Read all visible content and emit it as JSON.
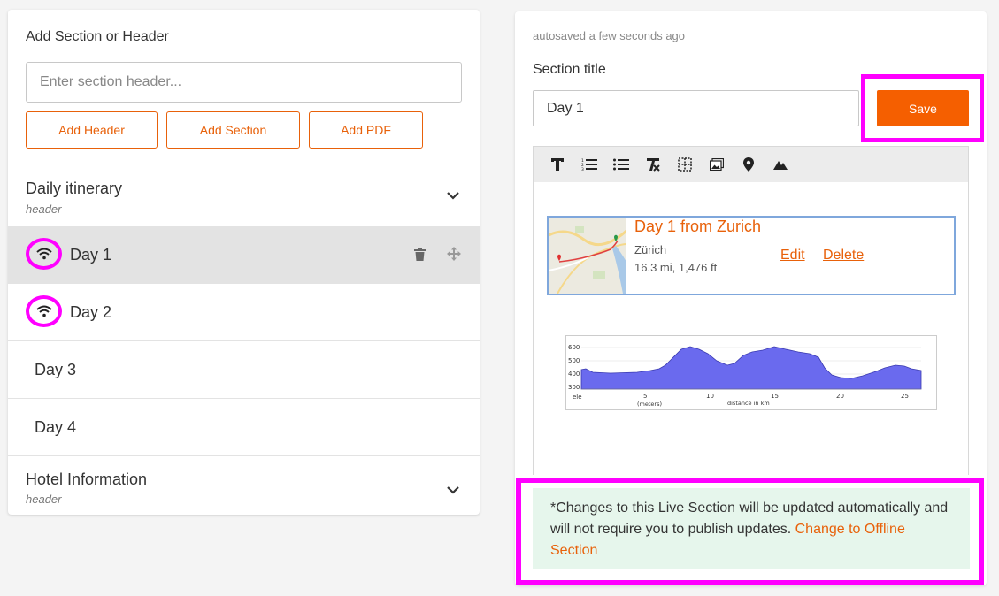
{
  "left": {
    "add_title": "Add Section or Header",
    "input_placeholder": "Enter section header...",
    "buttons": {
      "add_header": "Add Header",
      "add_section": "Add Section",
      "add_pdf": "Add PDF"
    },
    "groups": [
      {
        "title": "Daily itinerary",
        "subtitle": "header"
      },
      {
        "title": "Hotel Information",
        "subtitle": "header"
      }
    ],
    "days": [
      {
        "label": "Day 1"
      },
      {
        "label": "Day 2"
      },
      {
        "label": "Day 3"
      },
      {
        "label": "Day 4"
      }
    ]
  },
  "right": {
    "autosave": "autosaved a few seconds ago",
    "section_title_label": "Section title",
    "section_title_value": "Day 1",
    "save_label": "Save",
    "toolbar_icons": [
      "text-format-icon",
      "numbered-list-icon",
      "bullet-list-icon",
      "clear-format-icon",
      "table-icon",
      "image-icon",
      "map-pin-icon",
      "mountain-icon"
    ],
    "map_card": {
      "title": "Day 1 from Zurich",
      "location": "Zürich",
      "stats": "16.3 mi, 1,476 ft",
      "edit": "Edit",
      "delete": "Delete"
    },
    "elevation": {
      "y_ticks": [
        "600",
        "500",
        "400",
        "300"
      ],
      "x_ticks": [
        "5",
        "10",
        "15",
        "20",
        "25"
      ],
      "y_label": "ele",
      "y_unit": "(meters)",
      "x_label": "distance in km"
    },
    "notice": {
      "text": "*Changes to this Live Section will be updated automatically and will not require you to publish updates. ",
      "link": "Change to Offline Section"
    }
  },
  "colors": {
    "accent": "#e8610a",
    "save_bg": "#f55f00",
    "highlight": "#ff00ff",
    "notice_bg": "#e6f6ec",
    "selected_row": "#e3e3e3"
  }
}
